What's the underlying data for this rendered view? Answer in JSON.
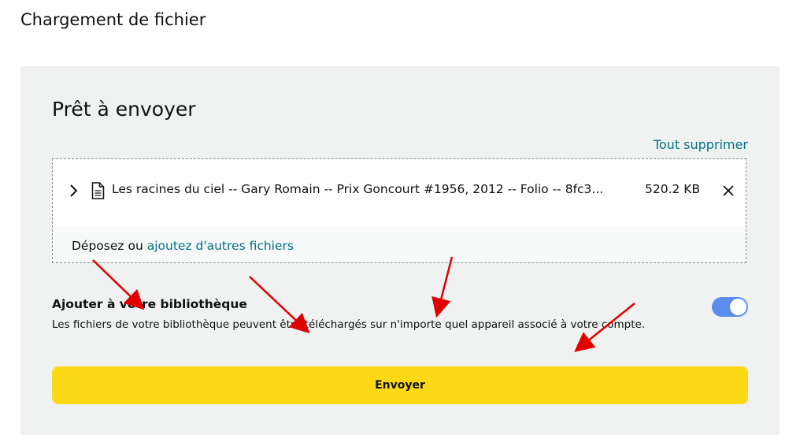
{
  "page": {
    "title": "Chargement de fichier"
  },
  "upload_panel": {
    "title": "Prêt à envoyer",
    "clear_all_label": "Tout supprimer",
    "files": [
      {
        "name": "Les racines du ciel -- Gary Romain -- Prix Goncourt #1956, 2012 -- Folio -- 8fc3...",
        "size": "520.2 KB"
      }
    ],
    "drop_text": "Déposez ou",
    "drop_link": "ajoutez d'autres fichiers"
  },
  "library": {
    "title": "Ajouter à votre bibliothèque",
    "description": "Les fichiers de votre bibliothèque peuvent être téléchargés sur n'importe quel appareil associé à votre compte.",
    "toggle_on": true
  },
  "actions": {
    "send_label": "Envoyer"
  },
  "colors": {
    "accent_link": "#007185",
    "button_yellow": "#fcd917",
    "toggle_blue": "#5b8def",
    "annotation_red": "#e00000"
  },
  "icons": {
    "expand": "chevron-right-icon",
    "file": "document-icon",
    "remove": "close-icon"
  }
}
